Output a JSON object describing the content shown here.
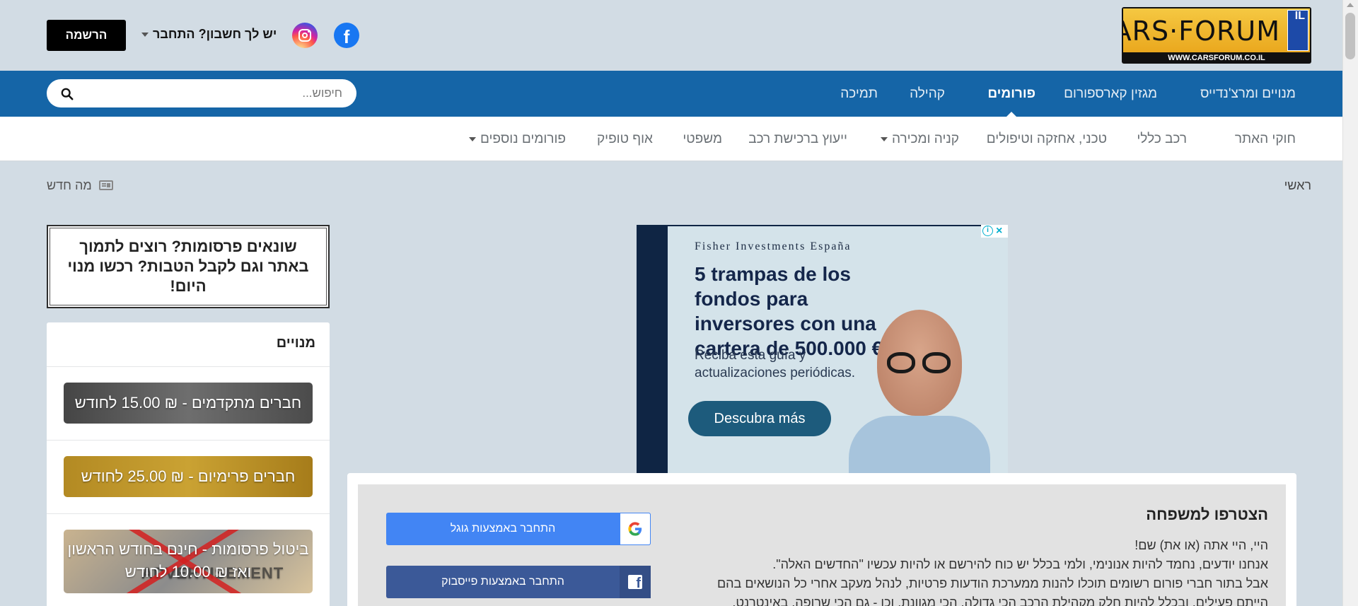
{
  "header": {
    "logo_text": "CARS·FORUM",
    "logo_plate": "IL",
    "logo_url": "WWW.CARSFORUM.CO.IL",
    "login_label": "יש לך חשבון? התחבר",
    "register_label": "הרשמה"
  },
  "nav": {
    "items": [
      {
        "label": "מנויים ומרצ'נדייס"
      },
      {
        "label": "מגזין קארספורום"
      },
      {
        "label": "פורומים"
      },
      {
        "label": "קהילה"
      },
      {
        "label": "תמיכה"
      }
    ],
    "active": "פורומים",
    "search_placeholder": "חיפוש..."
  },
  "subnav": {
    "items": [
      {
        "label": "חוקי האתר"
      },
      {
        "label": "רכב כללי"
      },
      {
        "label": "טכני, אחזקה וטיפולים"
      },
      {
        "label": "קניה ומכירה"
      },
      {
        "label": "ייעוץ ברכישת רכב"
      },
      {
        "label": "משפטי"
      },
      {
        "label": "אוף טופיק"
      },
      {
        "label": "פורומים נוספים"
      }
    ]
  },
  "breadcrumb": {
    "home": "ראשי"
  },
  "whatsnew_label": "מה חדש",
  "sidebar": {
    "promo_text": "שונאים פרסומות? רוצים לתמוך באתר וגם לקבל הטבות? רכשו מנוי היום!",
    "subscriptions_title": "מנויים",
    "plans": [
      {
        "label": "חברים מתקדמים - ₪ 15.00 לחודש"
      },
      {
        "label": "חברים פרימיום - ₪ 25.00 לחודש"
      },
      {
        "label": "ביטול פרסומות - חינם בחודש הראשון ואז ₪ 10.00 לחודש"
      }
    ]
  },
  "ad": {
    "brand": "Fisher Investments España",
    "headline": "5 trampas de los fondos para inversores con una cartera de 500.000 €",
    "body": "Reciba esta guía y actualizaciones periódicas.",
    "cta": "Descubra más"
  },
  "join": {
    "title": "הצטרפו למשפחה",
    "line1": "היי, היי אתה (או את) שם!",
    "line2": "אנחנו יודעים, נחמד להיות אנונימי, ולמי בכלל יש כוח להירשם או להיות עכשיו \"החדשים האלה\".",
    "line3": "אבל בתור חברי פורום רשומים תוכלו להנות ממערכת הודעות פרטיות, לנהל מעקב אחרי כל הנושאים בהם",
    "line4": "הייתם פעילים, ובכלל להיות חלק מקהילת הרכב הכי גדולה, הכי מגוונת, וכן - גם הכי שרופה, באינטרנט.",
    "google_label": "התחבר באמצעות גוגל",
    "facebook_label": "התחבר באמצעות פייסבוק"
  },
  "colors": {
    "nav_bg": "#1565a7",
    "page_bg": "#d2dce4",
    "google": "#4285f4",
    "facebook": "#3b5998"
  }
}
